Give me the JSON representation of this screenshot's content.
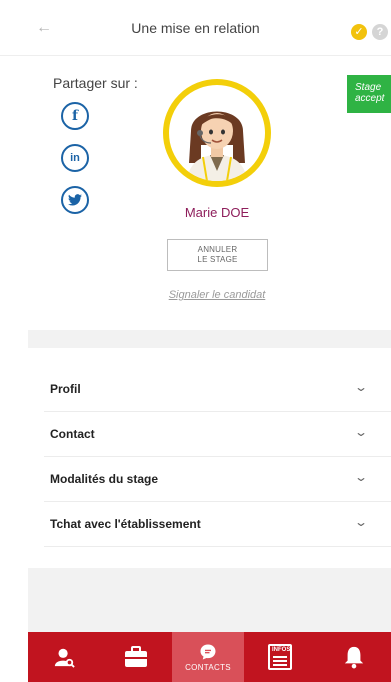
{
  "header": {
    "back_icon": "arrow-left-icon",
    "title": "Une mise en relation",
    "status_icon": "check-circle-icon",
    "help_icon": "question-circle-icon",
    "accent": "#f2c20d"
  },
  "share": {
    "label": "Partager sur :",
    "facebook": "f",
    "linkedin": "in",
    "twitter_icon": "twitter-bird-icon"
  },
  "candidate": {
    "name": "Marie DOE",
    "avatar_ring_color": "#f3cf0a",
    "name_color": "#8e1e5b"
  },
  "actions": {
    "cancel_line1": "ANNULER",
    "cancel_line2": "LE STAGE",
    "report": "Signaler le candidat"
  },
  "status_tag": {
    "line1": "Stage",
    "line2": "accept",
    "color": "#2fb344"
  },
  "accordion": [
    {
      "label": "Profil"
    },
    {
      "label": "Contact"
    },
    {
      "label": "Modalités du stage"
    },
    {
      "label": "Tchat avec l'établissement"
    }
  ],
  "nav": {
    "color": "#c1141f",
    "active_color": "#d95059",
    "items": [
      {
        "icon": "user-search-icon",
        "label": ""
      },
      {
        "icon": "briefcase-icon",
        "label": ""
      },
      {
        "icon": "chat-bubble-icon",
        "label": "CONTACTS"
      },
      {
        "icon": "infos-list-icon",
        "label": "INFOS"
      },
      {
        "icon": "bell-icon",
        "label": ""
      }
    ]
  }
}
